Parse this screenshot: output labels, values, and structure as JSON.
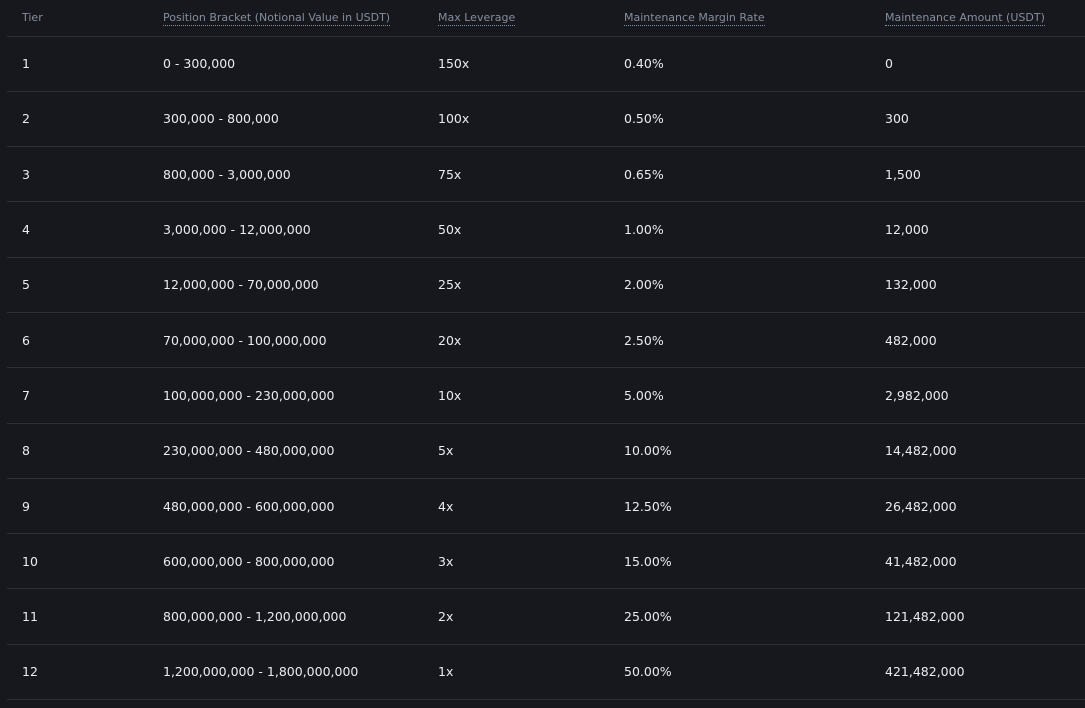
{
  "table": {
    "headers": [
      "Tier",
      "Position Bracket (Notional Value in USDT)",
      "Max Leverage",
      "Maintenance Margin Rate",
      "Maintenance Amount (USDT)"
    ],
    "rows": [
      [
        "1",
        "0 - 300,000",
        "150x",
        "0.40%",
        "0"
      ],
      [
        "2",
        "300,000 - 800,000",
        "100x",
        "0.50%",
        "300"
      ],
      [
        "3",
        "800,000 - 3,000,000",
        "75x",
        "0.65%",
        "1,500"
      ],
      [
        "4",
        "3,000,000 - 12,000,000",
        "50x",
        "1.00%",
        "12,000"
      ],
      [
        "5",
        "12,000,000 - 70,000,000",
        "25x",
        "2.00%",
        "132,000"
      ],
      [
        "6",
        "70,000,000 - 100,000,000",
        "20x",
        "2.50%",
        "482,000"
      ],
      [
        "7",
        "100,000,000 - 230,000,000",
        "10x",
        "5.00%",
        "2,982,000"
      ],
      [
        "8",
        "230,000,000 - 480,000,000",
        "5x",
        "10.00%",
        "14,482,000"
      ],
      [
        "9",
        "480,000,000 - 600,000,000",
        "4x",
        "12.50%",
        "26,482,000"
      ],
      [
        "10",
        "600,000,000 - 800,000,000",
        "3x",
        "15.00%",
        "41,482,000"
      ],
      [
        "11",
        "800,000,000 - 1,200,000,000",
        "2x",
        "25.00%",
        "121,482,000"
      ],
      [
        "12",
        "1,200,000,000 - 1,800,000,000",
        "1x",
        "50.00%",
        "421,482,000"
      ]
    ]
  },
  "colors": {
    "background": "#17181d",
    "header_text": "#848e9c",
    "cell_text": "#eaecef",
    "divider": "#2b2f36"
  }
}
